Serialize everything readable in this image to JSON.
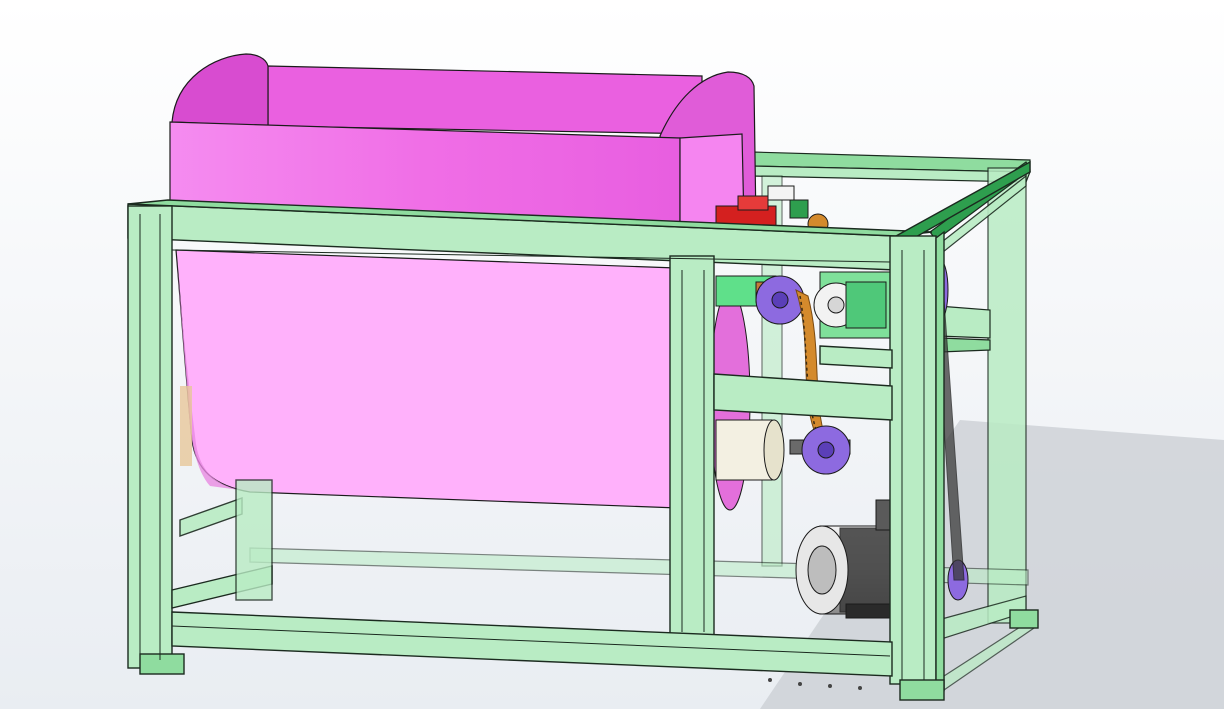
{
  "viewport": {
    "colors": {
      "background_top": "#ffffff",
      "background_bottom": "#e9edf2",
      "frame_fill": "#b9ecc4",
      "frame_fill_dark": "#8fdc9f",
      "frame_top_dark": "#2e9e4e",
      "frame_edge": "#1b2a1f",
      "drum_fill": "#f06ee6",
      "drum_inner": "#e25ad9",
      "drum_transparent": "#ffb1fb",
      "sprocket": "#8d6ae0",
      "chain": "#d48a2c",
      "red_bearing": "#d4201f",
      "motor_body": "#d9d9d9",
      "motor_dark": "#3a3a3a",
      "shadow": "#c7cbd1",
      "roller": "#f3f0e2"
    },
    "components": [
      {
        "name": "drum",
        "icon": "tumbling-drum-icon"
      },
      {
        "name": "frame",
        "icon": "steel-frame-icon"
      },
      {
        "name": "sprocket-upper",
        "icon": "sprocket-icon"
      },
      {
        "name": "sprocket-lower",
        "icon": "sprocket-icon"
      },
      {
        "name": "chain",
        "icon": "chain-icon"
      },
      {
        "name": "bearing-block",
        "icon": "bearing-icon"
      },
      {
        "name": "electric-motor",
        "icon": "motor-icon"
      },
      {
        "name": "reducer",
        "icon": "gearbox-icon"
      },
      {
        "name": "belt-pulley",
        "icon": "pulley-icon"
      }
    ]
  }
}
